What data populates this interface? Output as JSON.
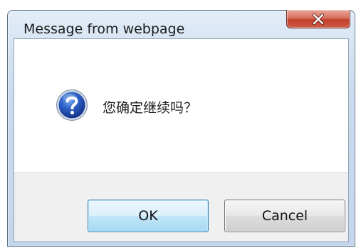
{
  "dialog": {
    "title": "Message from webpage",
    "close_glyph": "X",
    "message": "您确定继续吗？",
    "icon": "question-icon",
    "ok_label": "OK",
    "cancel_label": "Cancel"
  },
  "colors": {
    "title_bar": "#c9daee",
    "close_button": "#c2402b",
    "ok_button": "#bfe5f8",
    "cancel_button": "#dcdcdc",
    "footer": "#f0f0f0"
  }
}
